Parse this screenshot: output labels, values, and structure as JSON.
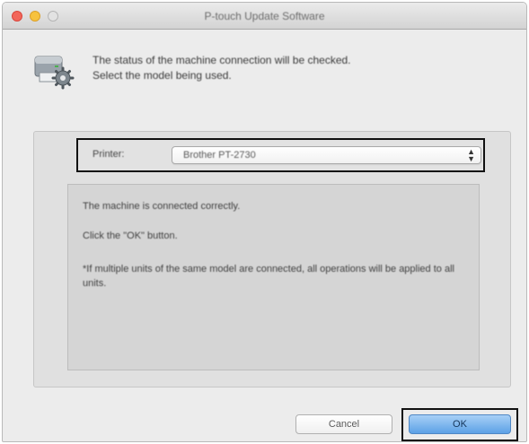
{
  "window": {
    "title": "P-touch Update Software"
  },
  "header": {
    "line1": "The status of the machine connection will be checked.",
    "line2": "Select the model being used."
  },
  "printer": {
    "label": "Printer:",
    "selected": "Brother PT-2730"
  },
  "messages": {
    "line1": "The machine is connected correctly.",
    "line2": "Click the \"OK\" button.",
    "line3": "*If multiple units of the same model are connected, all operations will be applied to all units."
  },
  "buttons": {
    "cancel": "Cancel",
    "ok": "OK"
  },
  "colors": {
    "ok_button": "#6eaeea",
    "close": "#f2665a",
    "minimize": "#f7c23e",
    "highlight_frame": "#111111"
  },
  "icons": {
    "app": "printer-gear-icon"
  }
}
